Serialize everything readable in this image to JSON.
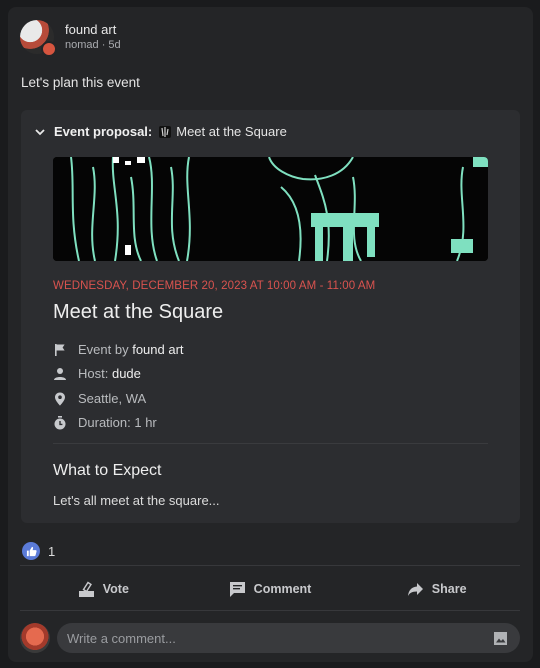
{
  "post": {
    "author": "found art",
    "meta": "nomad · 5d",
    "text": "Let's plan this event"
  },
  "event": {
    "proposal_label": "Event proposal:",
    "proposal_name": "Meet at the Square",
    "datetime": "WEDNESDAY, DECEMBER 20, 2023 AT 10:00 AM - 11:00 AM",
    "title": "Meet at the Square",
    "by_prefix": "Event by",
    "by_name": "found art",
    "host_prefix": "Host:",
    "host_name": "dude",
    "location": "Seattle, WA",
    "duration": "Duration: 1 hr",
    "expect_heading": "What to Expect",
    "expect_text": "Let's all meet at the square..."
  },
  "reactions": {
    "count": "1"
  },
  "actions": {
    "vote": "Vote",
    "comment": "Comment",
    "share": "Share"
  },
  "comment": {
    "placeholder": "Write a comment..."
  },
  "colors": {
    "accent_date": "#d9534f",
    "banner_line": "#7fe0c0",
    "like": "#5b7bd8"
  }
}
